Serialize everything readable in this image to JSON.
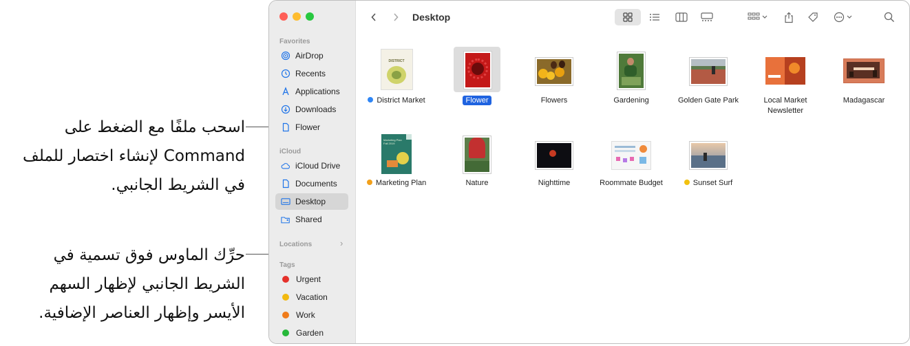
{
  "callouts": {
    "top": "اسحب ملفًا مع الضغط على Command لإنشاء اختصار للملف في الشريط الجانبي.",
    "bottom": "حرِّك الماوس فوق تسمية في الشريط الجانبي لإظهار السهم الأيسر وإظهار العناصر الإضافية."
  },
  "window": {
    "title": "Desktop"
  },
  "sidebar": {
    "favorites_label": "Favorites",
    "favorites": [
      {
        "label": "AirDrop",
        "icon": "airdrop-icon"
      },
      {
        "label": "Recents",
        "icon": "clock-icon"
      },
      {
        "label": "Applications",
        "icon": "applications-icon"
      },
      {
        "label": "Downloads",
        "icon": "download-icon"
      },
      {
        "label": "Flower",
        "icon": "document-icon"
      }
    ],
    "icloud_label": "iCloud",
    "icloud": [
      {
        "label": "iCloud Drive",
        "icon": "cloud-icon"
      },
      {
        "label": "Documents",
        "icon": "document-icon"
      },
      {
        "label": "Desktop",
        "icon": "desktop-icon",
        "active": true
      },
      {
        "label": "Shared",
        "icon": "shared-folder-icon"
      }
    ],
    "locations_label": "Locations",
    "tags_label": "Tags",
    "tags": [
      {
        "label": "Urgent",
        "color": "#e5312b"
      },
      {
        "label": "Vacation",
        "color": "#f2b90f"
      },
      {
        "label": "Work",
        "color": "#f07c1b"
      },
      {
        "label": "Garden",
        "color": "#27b83a"
      }
    ]
  },
  "files": [
    {
      "name": "District Market",
      "tag_color": "#2f86f5"
    },
    {
      "name": "Flower",
      "selected": true
    },
    {
      "name": "Flowers"
    },
    {
      "name": "Gardening"
    },
    {
      "name": "Golden Gate Park"
    },
    {
      "name": "Local Market Newsletter"
    },
    {
      "name": "Madagascar"
    },
    {
      "name": "Marketing Plan",
      "tag_color": "#f2a01b"
    },
    {
      "name": "Nature"
    },
    {
      "name": "Nighttime"
    },
    {
      "name": "Roommate Budget"
    },
    {
      "name": "Sunset Surf",
      "tag_color": "#f2c10f"
    }
  ],
  "thumb_text": {
    "district": "DISTRICT",
    "marketing": "Marketing Plan Fall 2019"
  }
}
